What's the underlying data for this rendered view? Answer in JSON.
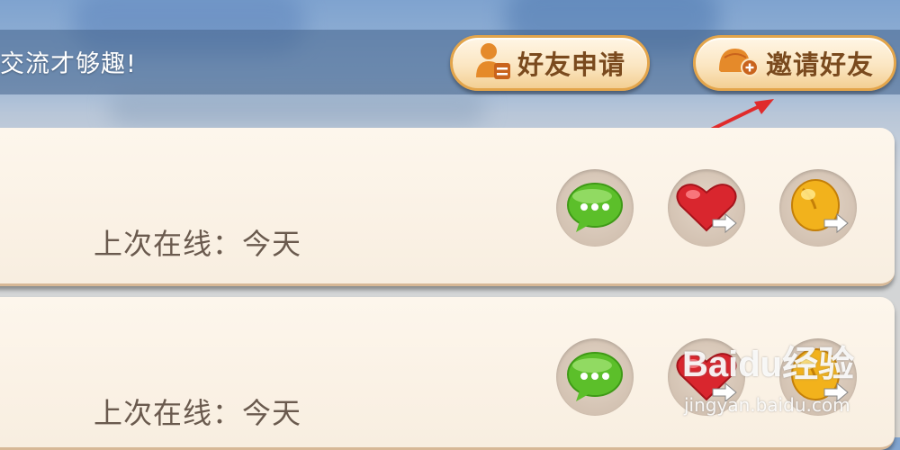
{
  "header": {
    "slogan": "交流才够趣!",
    "friend_request_label": "好友申请",
    "invite_friend_label": "邀请好友"
  },
  "friends": [
    {
      "last_online": "上次在线：今天",
      "actions": [
        "chat-icon",
        "send-heart-icon",
        "send-bean-icon"
      ]
    },
    {
      "last_online": "上次在线：今天",
      "actions": [
        "chat-icon",
        "send-heart-icon",
        "send-bean-icon"
      ]
    }
  ],
  "annotation": {
    "arrow_color": "#e02b2b"
  },
  "watermark": {
    "brand": "Baidu经验",
    "url": "jingyan.baidu.com"
  },
  "colors": {
    "button_text": "#7a4a1e",
    "button_border": "#e3a54b",
    "card_bg": "#fdf6ec"
  }
}
